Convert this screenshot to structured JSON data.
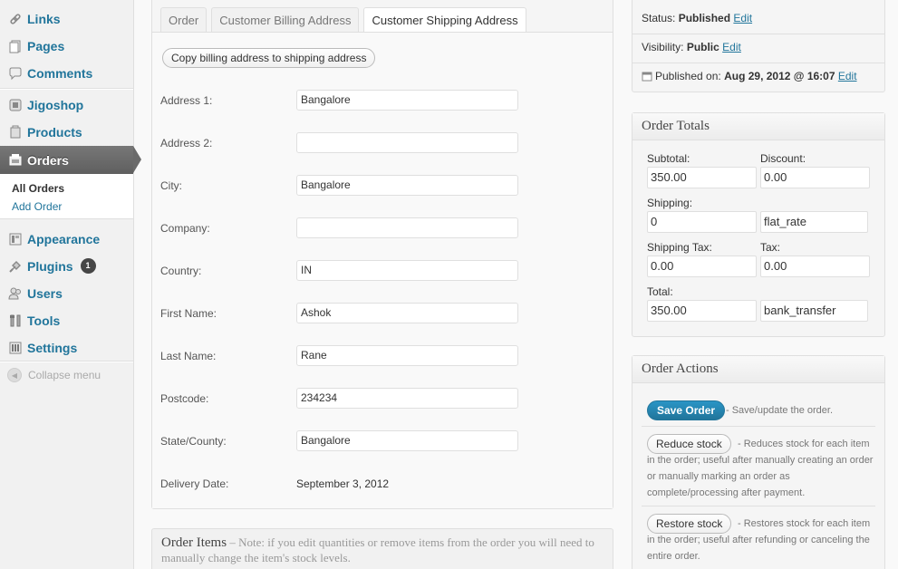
{
  "sidebar": {
    "items": [
      {
        "label": "Links",
        "icon": "link-icon"
      },
      {
        "label": "Pages",
        "icon": "pages-icon"
      },
      {
        "label": "Comments",
        "icon": "comments-icon"
      },
      {
        "label": "Jigoshop",
        "icon": "jigoshop-icon"
      },
      {
        "label": "Products",
        "icon": "products-icon"
      },
      {
        "label": "Orders",
        "icon": "orders-icon"
      },
      {
        "label": "Appearance",
        "icon": "appearance-icon"
      },
      {
        "label": "Plugins",
        "icon": "plugins-icon",
        "badge": "1"
      },
      {
        "label": "Users",
        "icon": "users-icon"
      },
      {
        "label": "Tools",
        "icon": "tools-icon"
      },
      {
        "label": "Settings",
        "icon": "settings-icon"
      }
    ],
    "submenu": [
      "All Orders",
      "Add Order"
    ],
    "collapse_label": "Collapse menu"
  },
  "main": {
    "tabs": [
      "Order",
      "Customer Billing Address",
      "Customer Shipping Address"
    ],
    "copy_button": "Copy billing address to shipping address",
    "fields": [
      {
        "label": "Address 1:",
        "value": "Bangalore"
      },
      {
        "label": "Address 2:",
        "value": ""
      },
      {
        "label": "City:",
        "value": "Bangalore"
      },
      {
        "label": "Company:",
        "value": ""
      },
      {
        "label": "Country:",
        "value": "IN"
      },
      {
        "label": "First Name:",
        "value": "Ashok"
      },
      {
        "label": "Last Name:",
        "value": "Rane"
      },
      {
        "label": "Postcode:",
        "value": "234234"
      },
      {
        "label": "State/County:",
        "value": "Bangalore"
      }
    ],
    "delivery_label": "Delivery Date:",
    "delivery_value": "September 3, 2012",
    "order_items_title": "Order Items",
    "order_items_note": " – Note: if you edit quantities or remove items from the order you will need to manually change the item's stock levels."
  },
  "publish": {
    "status_label": "Status:",
    "status_value": "Published",
    "visibility_label": "Visibility:",
    "visibility_value": "Public",
    "published_label": "Published on:",
    "published_value": "Aug 29, 2012 @ 16:07",
    "edit": "Edit"
  },
  "totals": {
    "title": "Order Totals",
    "subtotal_label": "Subtotal:",
    "subtotal": "350.00",
    "discount_label": "Discount:",
    "discount": "0.00",
    "shipping_label": "Shipping:",
    "shipping": "0",
    "shipping_method": "flat_rate",
    "shipping_tax_label": "Shipping Tax:",
    "shipping_tax": "0.00",
    "tax_label": "Tax:",
    "tax": "0.00",
    "total_label": "Total:",
    "total": "350.00",
    "payment_method": "bank_transfer"
  },
  "actions": {
    "title": "Order Actions",
    "save": "Save Order",
    "save_desc": "- Save/update the order.",
    "reduce": "Reduce stock",
    "reduce_desc": "- Reduces stock for each item in the order; useful after manually creating an order or manually marking an order as complete/processing after payment.",
    "restore": "Restore stock",
    "restore_desc": "- Restores stock for each item in the order; useful after refunding or canceling the entire order."
  },
  "colors": {
    "link": "#21759b",
    "current_menu": "#6a6a6a",
    "primary_button": "#21759b"
  }
}
